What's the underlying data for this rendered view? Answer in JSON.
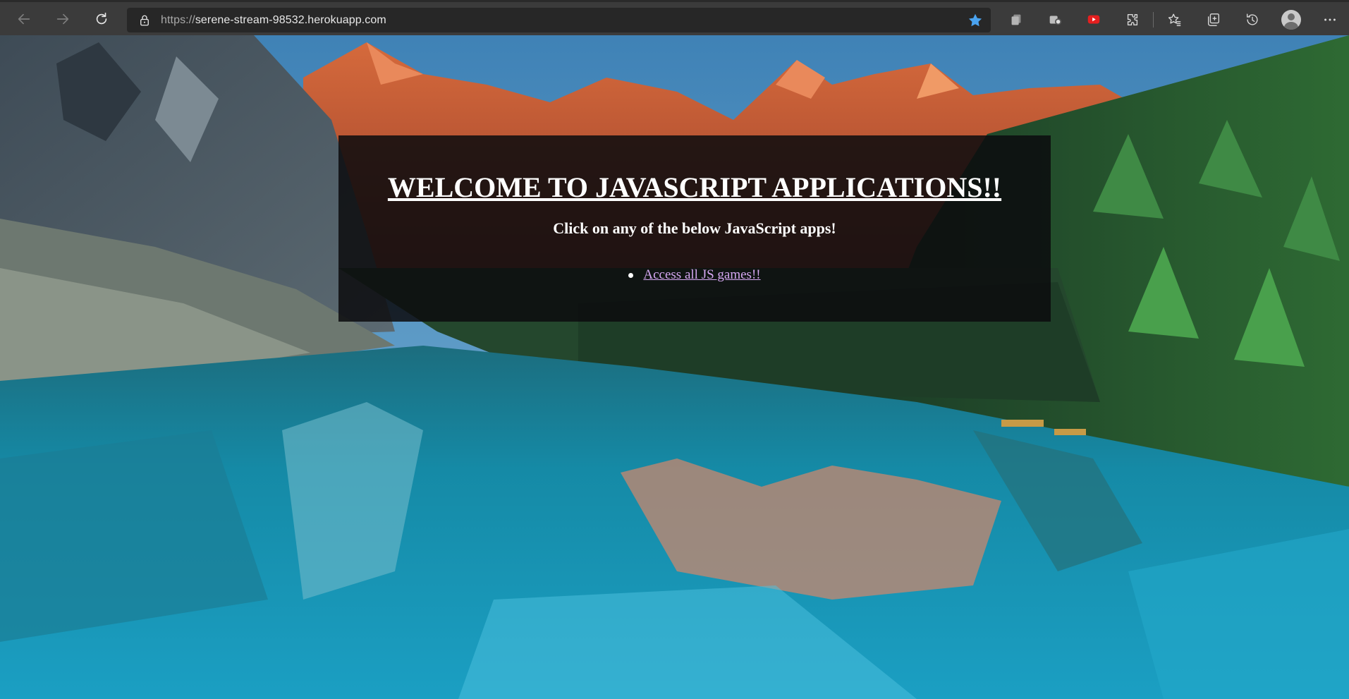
{
  "browser": {
    "url_scheme": "https://",
    "url_host": "serene-stream-98532.herokuapp.com",
    "accent_color": "#4aa3f0",
    "icons": [
      "back-icon",
      "forward-icon",
      "refresh-icon",
      "lock-icon",
      "favorite-star-icon",
      "collections-icon",
      "extension-icon",
      "youtube-extension-icon",
      "extensions-puzzle-icon",
      "favorites-icon",
      "collections-add-icon",
      "history-icon",
      "profile-avatar",
      "more-menu-icon"
    ]
  },
  "page": {
    "title": "WELCOME TO JAVASCRIPT APPLICATIONS!!",
    "subtitle": "Click on any of the below JavaScript apps!",
    "links": [
      {
        "label": "Access all JS games!!"
      }
    ],
    "link_color": "#d6a8f3",
    "panel_color": "#0c0c0e"
  }
}
